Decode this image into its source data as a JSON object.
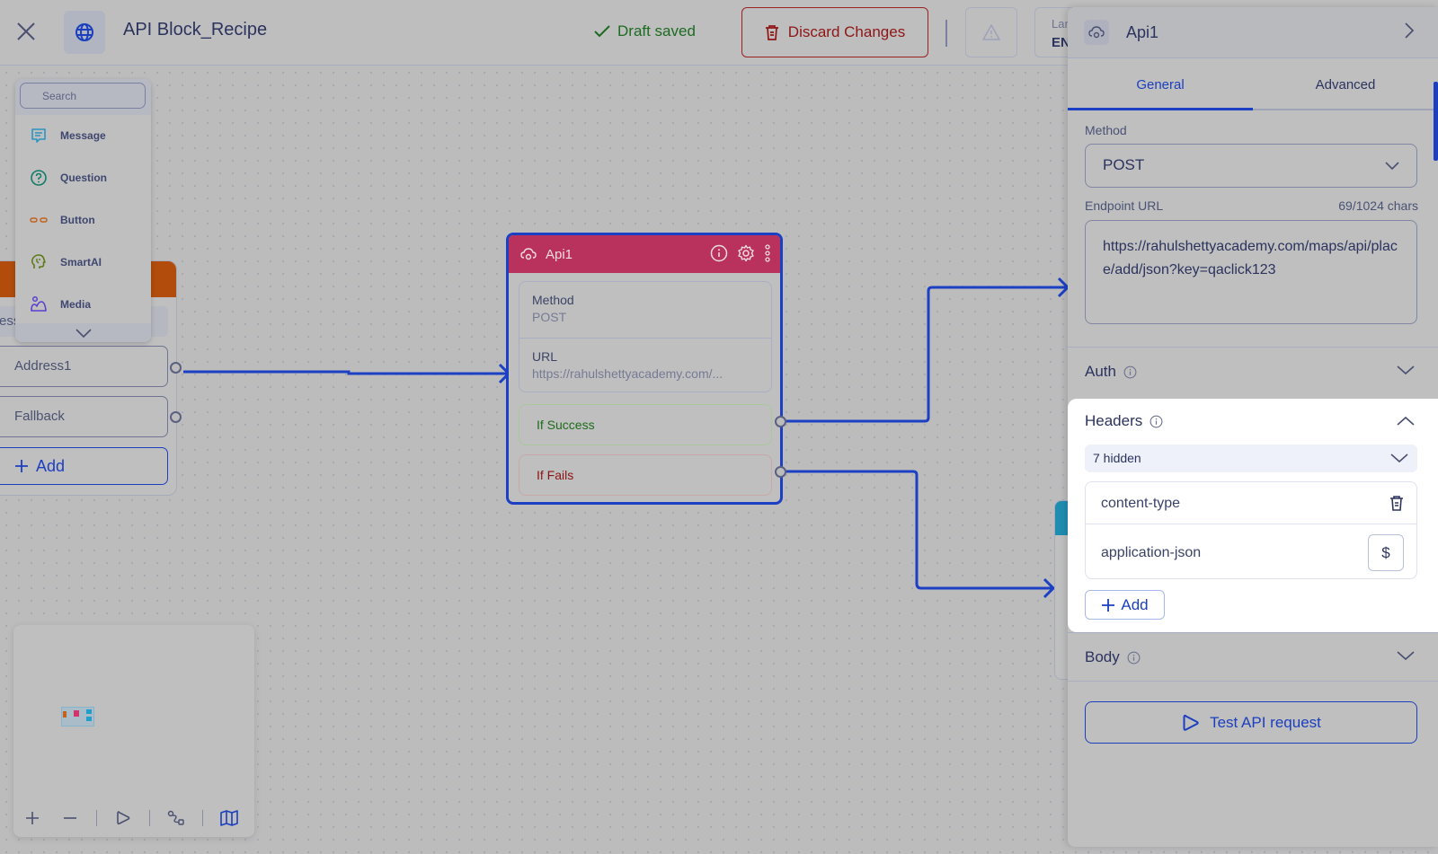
{
  "topbar": {
    "title": "API Block_Recipe",
    "draft_status": "Draft saved",
    "discard_label": "Discard Changes",
    "language_label": "Language",
    "language_value": "EN"
  },
  "palette": {
    "search_placeholder": "Search",
    "items": [
      {
        "label": "Message",
        "icon": "message-icon",
        "color": "#2a95c0"
      },
      {
        "label": "Question",
        "icon": "question-icon",
        "color": "#137a66"
      },
      {
        "label": "Button",
        "icon": "button-icon",
        "color": "#c2621e"
      },
      {
        "label": "SmartAI",
        "icon": "smartai-icon",
        "color": "#5c7a16"
      },
      {
        "label": "Media",
        "icon": "media-icon",
        "color": "#5a3fd0"
      }
    ]
  },
  "left_node": {
    "message_snippet": "ess",
    "options": [
      "Address1",
      "Fallback"
    ],
    "add_label": "Add"
  },
  "api_node": {
    "title": "Api1",
    "method_label": "Method",
    "method_value": "POST",
    "url_label": "URL",
    "url_value": "https://rahulshettyacademy.com/...",
    "success_label": "If Success",
    "fail_label": "If Fails"
  },
  "panel": {
    "title": "Api1",
    "tabs": [
      {
        "label": "General",
        "active": true
      },
      {
        "label": "Advanced",
        "active": false
      }
    ],
    "method_label": "Method",
    "method_value": "POST",
    "endpoint_label": "Endpoint URL",
    "char_count": "69/1024 chars",
    "endpoint_value": "https://rahulshettyacademy.com/maps/api/place/add/json?key=qaclick123",
    "auth_label": "Auth",
    "headers": {
      "label": "Headers",
      "hidden_toggle": "7 hidden",
      "key": "content-type",
      "value": "application-json",
      "var_label": "$",
      "add_label": "Add"
    },
    "body_label": "Body",
    "test_label": "Test API request"
  },
  "colors": {
    "accent": "#1b40c4",
    "api_header": "#b8325d",
    "left_node_header": "#b14c0c",
    "peek_node_header": "#1f8db0",
    "success": "#1e6c1b",
    "danger": "#8e1616"
  }
}
